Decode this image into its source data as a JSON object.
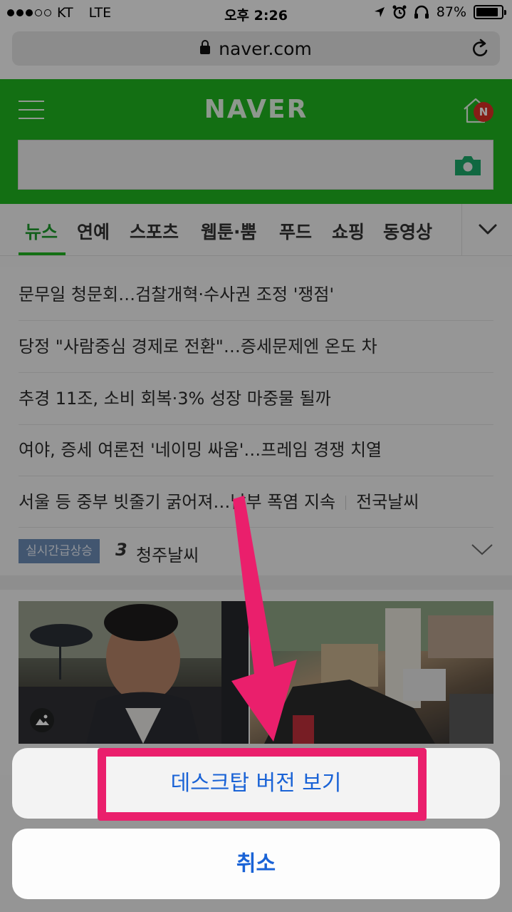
{
  "status_bar": {
    "carrier": "KT",
    "network": "LTE",
    "time": "오후 2:26",
    "battery": "87%",
    "battery_level": 0.87
  },
  "browser": {
    "url": "naver.com"
  },
  "header": {
    "logo": "NAVER",
    "badge": "N"
  },
  "tabs": [
    {
      "label": "뉴스"
    },
    {
      "label": "연예"
    },
    {
      "label": "스포츠"
    },
    {
      "label": "웹툰·뿜"
    },
    {
      "label": "푸드"
    },
    {
      "label": "쇼핑"
    },
    {
      "label": "동영상"
    }
  ],
  "news": [
    {
      "title": "문무일 청문회…검찰개혁·수사권 조정 '쟁점'"
    },
    {
      "title": "당정 \"사람중심 경제로 전환\"…증세문제엔 온도 차"
    },
    {
      "title": "추경 11조, 소비 회복·3% 성장 마중물 될까"
    },
    {
      "title": "여야, 증세 여론전 '네이밍 싸움'…프레임 경쟁 치열"
    },
    {
      "title": "서울 등 중부 빗줄기 굵어져…남부 폭염 지속",
      "extra": "전국날씨"
    }
  ],
  "trending": {
    "badge": "실시간급상승",
    "rank": "3",
    "keyword": "청주날씨"
  },
  "action_sheet": {
    "desktop_label": "데스크탑 버전 보기",
    "cancel_label": "취소"
  },
  "colors": {
    "naver_green": "#1fb31f",
    "highlight": "#ea1f6c",
    "ios_blue": "#1a63d6"
  }
}
